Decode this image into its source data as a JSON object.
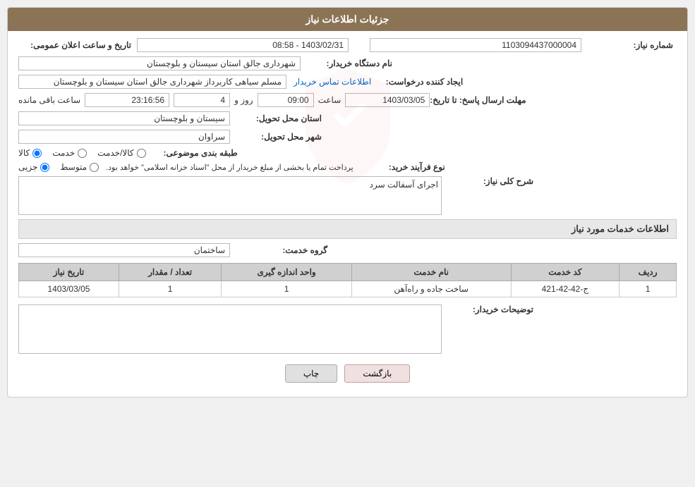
{
  "page": {
    "title": "جزئیات اطلاعات نیاز",
    "sections": {
      "need_info": "جزئیات اطلاعات نیاز",
      "services_info": "اطلاعات خدمات مورد نیاز"
    }
  },
  "header": {
    "title": "جزئیات اطلاعات نیاز"
  },
  "fields": {
    "need_number_label": "شماره نیاز:",
    "need_number_value": "1103094437000004",
    "publish_datetime_label": "تاریخ و ساعت اعلان عمومی:",
    "publish_datetime_value": "1403/02/31 - 08:58",
    "buyer_org_label": "نام دستگاه خریدار:",
    "buyer_org_value": "شهرداری جالق استان سیستان و بلوچستان",
    "creator_label": "ایجاد کننده درخواست:",
    "creator_value": "مسلم سیاهی کاربرداز شهرداری جالق استان سیستان و بلوچستان",
    "contact_link": "اطلاعات تماس خریدار",
    "deadline_label": "مهلت ارسال پاسخ: تا تاریخ:",
    "deadline_date": "1403/03/05",
    "deadline_time_label": "ساعت",
    "deadline_time": "09:00",
    "deadline_days_label": "روز و",
    "deadline_days": "4",
    "deadline_remaining_label": "ساعت باقی مانده",
    "deadline_remaining": "23:16:56",
    "province_label": "استان محل تحویل:",
    "province_value": "سیستان و بلوچستان",
    "city_label": "شهر محل تحویل:",
    "city_value": "سراوان",
    "category_label": "طبقه بندی موضوعی:",
    "category_options": [
      {
        "label": "کالا",
        "value": "kala"
      },
      {
        "label": "خدمت",
        "value": "khedmat"
      },
      {
        "label": "کالا/خدمت",
        "value": "kala_khedmat"
      }
    ],
    "category_selected": "kala",
    "purchase_type_label": "نوع فرآیند خرید:",
    "purchase_type_options": [
      {
        "label": "جزیی",
        "value": "jozi"
      },
      {
        "label": "متوسط",
        "value": "motavaset"
      }
    ],
    "purchase_type_note": "پرداخت تمام یا بخشی از مبلغ خریدار از محل \"اسناد خزانه اسلامی\" خواهد بود.",
    "description_label": "شرح کلی نیاز:",
    "description_value": "اجرای آسفالت سرد",
    "service_group_label": "گروه خدمت:",
    "service_group_value": "ساختمان",
    "buyer_notes_label": "توضیحات خریدار:"
  },
  "table": {
    "headers": [
      "ردیف",
      "کد خدمت",
      "نام خدمت",
      "واحد اندازه گیری",
      "تعداد / مقدار",
      "تاریخ نیاز"
    ],
    "rows": [
      {
        "row_num": "1",
        "service_code": "ج-42-42-421",
        "service_name": "ساخت جاده و راه‌آهن",
        "unit": "1",
        "quantity": "1",
        "need_date": "1403/03/05"
      }
    ]
  },
  "buttons": {
    "print": "چاپ",
    "back": "بازگشت"
  }
}
